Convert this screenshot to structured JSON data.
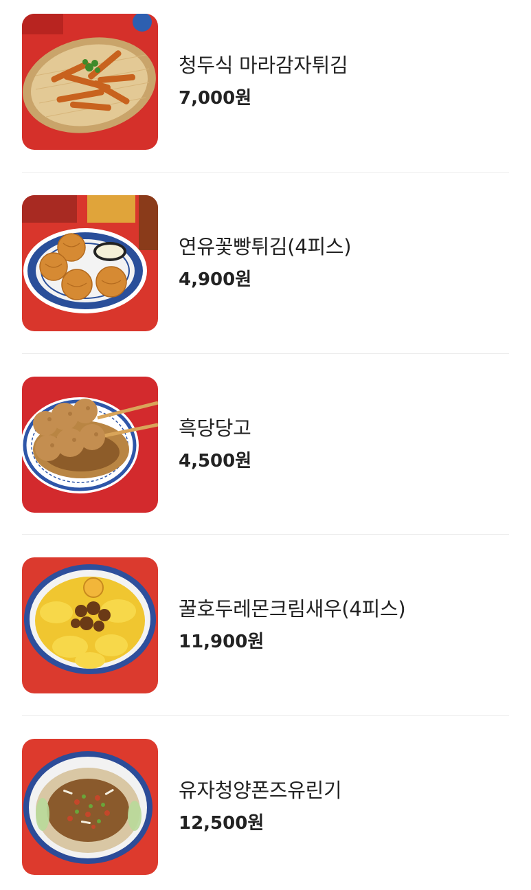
{
  "menu": {
    "items": [
      {
        "name": "청두식 마라감자튀김",
        "price": "7,000원",
        "image": "mala-potato-fries-photo"
      },
      {
        "name": "연유꽃빵튀김(4피스)",
        "price": "4,900원",
        "image": "fried-flower-bun-condensed-milk-photo"
      },
      {
        "name": "흑당당고",
        "price": "4,500원",
        "image": "brown-sugar-dango-photo"
      },
      {
        "name": "꿀호두레몬크림새우(4피스)",
        "price": "11,900원",
        "image": "honey-walnut-lemon-cream-shrimp-photo"
      },
      {
        "name": "유자청양폰즈유린기",
        "price": "12,500원",
        "image": "yuzu-chili-ponzu-yuringi-photo"
      }
    ]
  },
  "colors": {
    "photo_background": "#d9342b",
    "divider": "#ececec",
    "text": "#222222"
  }
}
